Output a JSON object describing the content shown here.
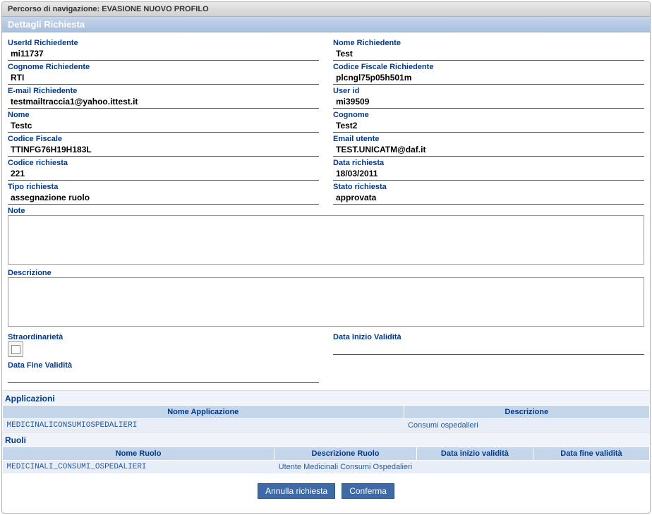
{
  "breadcrumb": "Percorso di navigazione: EVASIONE NUOVO PROFILO",
  "section_title": "Dettagli Richiesta",
  "fields": {
    "userid_richiedente_label": "UserId Richiedente",
    "userid_richiedente_value": "mi11737",
    "nome_richiedente_label": "Nome Richiedente",
    "nome_richiedente_value": "Test",
    "cognome_richiedente_label": "Cognome Richiedente",
    "cognome_richiedente_value": "RTI",
    "codice_fiscale_richiedente_label": "Codice Fiscale Richiedente",
    "codice_fiscale_richiedente_value": "plcngl75p05h501m",
    "email_richiedente_label": "E-mail Richiedente",
    "email_richiedente_value": "testmailtraccia1@yahoo.ittest.it",
    "user_id_label": "User id",
    "user_id_value": "mi39509",
    "nome_label": "Nome",
    "nome_value": "Testc",
    "cognome_label": "Cognome",
    "cognome_value": "Test2",
    "codice_fiscale_label": "Codice Fiscale",
    "codice_fiscale_value": "TTINFG76H19H183L",
    "email_utente_label": "Email utente",
    "email_utente_value": "TEST.UNICATM@daf.it",
    "codice_richiesta_label": "Codice richiesta",
    "codice_richiesta_value": "221",
    "data_richiesta_label": "Data richiesta",
    "data_richiesta_value": "18/03/2011",
    "tipo_richiesta_label": "Tipo richiesta",
    "tipo_richiesta_value": "assegnazione ruolo",
    "stato_richiesta_label": "Stato richiesta",
    "stato_richiesta_value": "approvata",
    "note_label": "Note",
    "note_value": "",
    "descrizione_label": "Descrizione",
    "descrizione_value": "",
    "straordinarieta_label": "Straordinarietà",
    "straordinarieta_checked": false,
    "data_inizio_validita_label": "Data Inizio Validità",
    "data_inizio_validita_value": "",
    "data_fine_validita_label": "Data Fine Validità",
    "data_fine_validita_value": ""
  },
  "applicazioni": {
    "title": "Applicazioni",
    "headers": {
      "nome": "Nome Applicazione",
      "descrizione": "Descrizione"
    },
    "rows": [
      {
        "nome": "MEDICINALICONSUMIOSPEDALIERI",
        "descrizione": "Consumi ospedalieri"
      }
    ]
  },
  "ruoli": {
    "title": "Ruoli",
    "headers": {
      "nome": "Nome Ruolo",
      "descrizione": "Descrizione Ruolo",
      "inizio": "Data inizio validità",
      "fine": "Data fine validità"
    },
    "rows": [
      {
        "nome": "MEDICINALI_CONSUMI_OSPEDALIERI",
        "descrizione": "Utente Medicinali Consumi Ospedalieri",
        "inizio": "",
        "fine": ""
      }
    ]
  },
  "buttons": {
    "annulla": "Annulla richiesta",
    "conferma": "Conferma"
  }
}
